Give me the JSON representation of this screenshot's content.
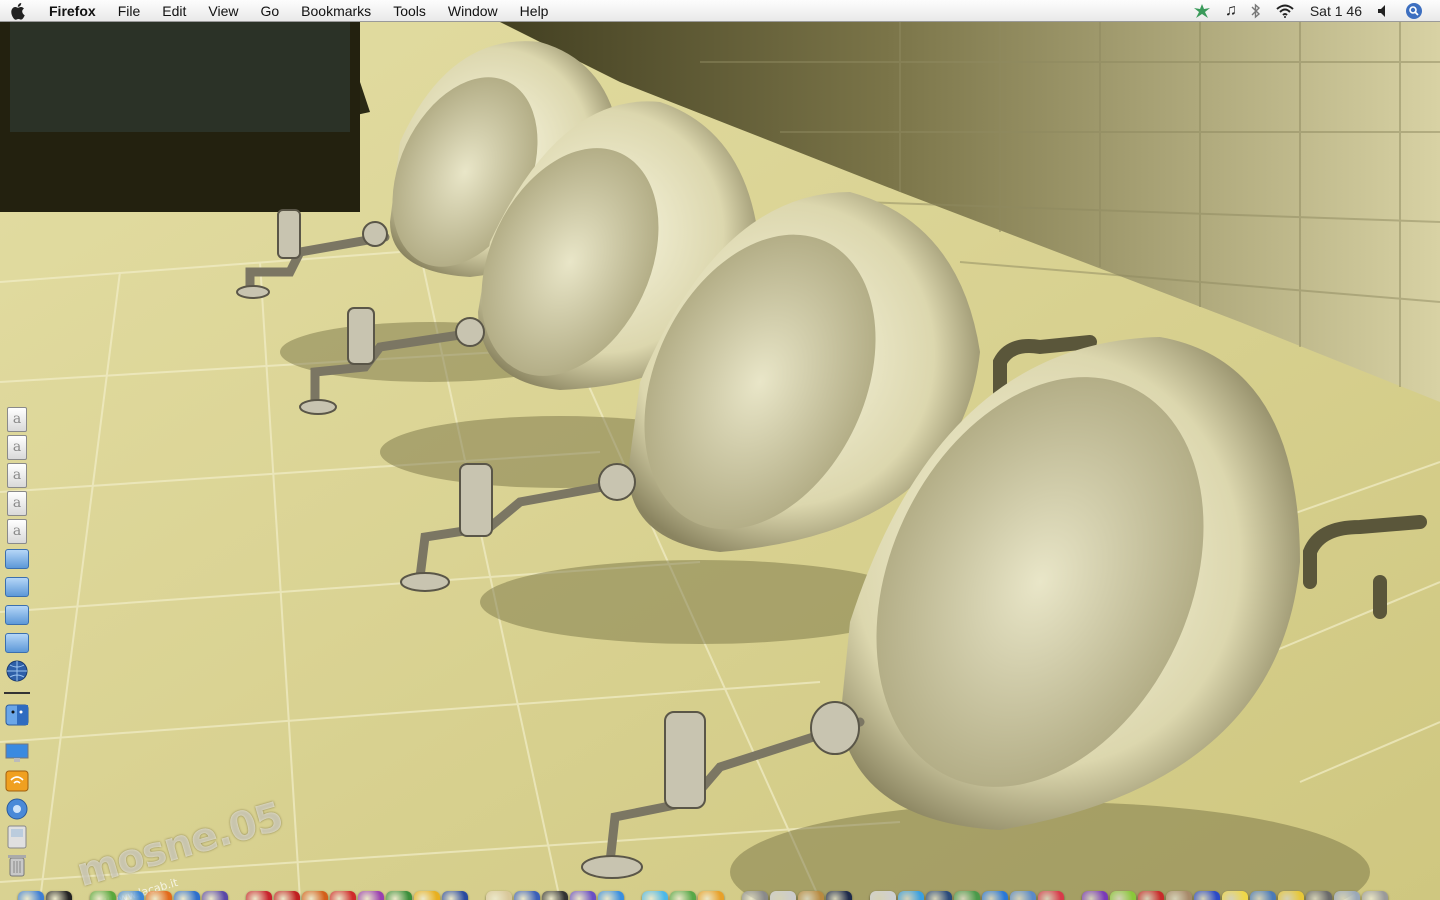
{
  "menubar": {
    "app_name": "Firefox",
    "menus": [
      "File",
      "Edit",
      "View",
      "Go",
      "Bookmarks",
      "Tools",
      "Window",
      "Help"
    ],
    "clock": "Sat 1 46"
  },
  "wallpaper": {
    "watermark": "mosne.05",
    "watermark_url": "http://www.lacab.it"
  },
  "side_stack": {
    "icons": [
      "doc-icon",
      "doc-icon",
      "doc-icon",
      "doc-icon",
      "doc-icon",
      "folder-icon",
      "folder-icon",
      "folder-icon",
      "folder-icon",
      "globe-icon",
      "finder-icon",
      "display-icon",
      "wifi-icon",
      "network-icon",
      "disk-icon",
      "trash-icon"
    ],
    "doc_letter": "a"
  },
  "dock": {
    "groups": [
      [
        "finder",
        "dashboard"
      ],
      [
        "ichat",
        "safari",
        "firefox",
        "ie",
        "camino"
      ],
      [
        "acrobat",
        "reader",
        "illustrator",
        "flash",
        "freehand",
        "fireworks",
        "director",
        "star"
      ],
      [
        "textedit",
        "imovie",
        "quicktime",
        "dvd",
        "itunes-disc"
      ],
      [
        "font",
        "preview",
        "photoshop"
      ],
      [
        "script",
        "chess",
        "popcorn",
        "terminal"
      ],
      [
        "ipod",
        "spotlight",
        "screen",
        "music",
        "player",
        "chat",
        "stop"
      ],
      [
        "orbit",
        "widget",
        "record",
        "cocoa",
        "blue",
        "stickies",
        "photo",
        "adium",
        "gear",
        "mail",
        "trash"
      ]
    ],
    "colors": {
      "finder": "#3f7fd4",
      "dashboard": "#222222",
      "ichat": "#5aa83c",
      "safari": "#3d86d6",
      "firefox": "#e26a1b",
      "ie": "#2e6fcc",
      "camino": "#5a48a8",
      "acrobat": "#c8232c",
      "reader": "#c02020",
      "illustrator": "#d35f1a",
      "flash": "#cf2a2a",
      "freehand": "#9a3fb0",
      "fireworks": "#3b8f3b",
      "director": "#e8b020",
      "star": "#2a4aa0",
      "textedit": "#d9c89a",
      "imovie": "#3a5fb8",
      "quicktime": "#333333",
      "dvd": "#6a4fc4",
      "itunes-disc": "#3a8fe0",
      "font": "#4db8e8",
      "preview": "#58a848",
      "photoshop": "#e8a028",
      "script": "#8a8a8a",
      "chess": "#cccccc",
      "popcorn": "#b88a40",
      "terminal": "#1e2a4a",
      "ipod": "#d0d0d0",
      "spotlight": "#3aa0e0",
      "screen": "#2a4a7a",
      "music": "#4a9a4a",
      "player": "#2a78d8",
      "chat": "#5a8ac8",
      "stop": "#d83a4a",
      "orbit": "#7a3ab8",
      "widget": "#8ac83a",
      "record": "#c82a2a",
      "cocoa": "#a88a6a",
      "blue": "#2a4ac8",
      "stickies": "#f0d848",
      "photo": "#4a7ab8",
      "adium": "#e8c838",
      "gear": "#6a6a6a",
      "mail": "#9aa8b8",
      "trash": "#9a9a9a"
    },
    "running": [
      "finder",
      "dashboard",
      "firefox",
      "itunes-disc",
      "ipod",
      "orbit",
      "adium"
    ]
  }
}
